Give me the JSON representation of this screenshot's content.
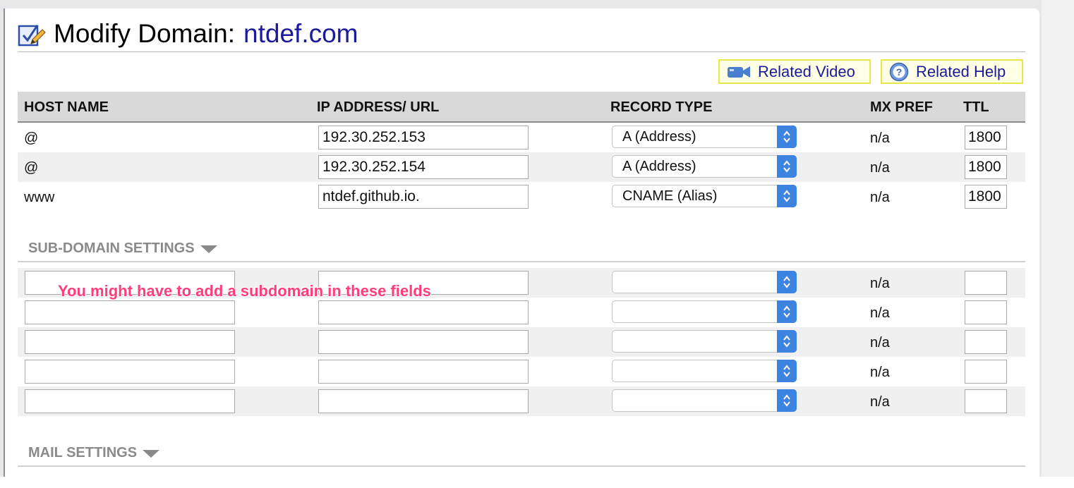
{
  "title": {
    "prefix": "Modify Domain:",
    "domain": "ntdef.com"
  },
  "related": {
    "video_label": "Related Video",
    "help_label": "Related Help"
  },
  "table": {
    "headers": {
      "host": "HOST NAME",
      "ip": "IP ADDRESS/ URL",
      "type": "RECORD TYPE",
      "mx": "MX PREF",
      "ttl": "TTL"
    },
    "records": [
      {
        "host": "@",
        "ip": "192.30.252.153",
        "type": "A (Address)",
        "mx": "n/a",
        "ttl": "1800"
      },
      {
        "host": "@",
        "ip": "192.30.252.154",
        "type": "A (Address)",
        "mx": "n/a",
        "ttl": "1800"
      },
      {
        "host": "www",
        "ip": "ntdef.github.io.",
        "type": "CNAME (Alias)",
        "mx": "n/a",
        "ttl": "1800"
      }
    ]
  },
  "subdomain": {
    "heading": "SUB-DOMAIN SETTINGS",
    "annotation": "You might have to add a subdomain in these fields",
    "rows": [
      {
        "host": "",
        "ip": "",
        "type": "",
        "mx": "n/a",
        "ttl": ""
      },
      {
        "host": "",
        "ip": "",
        "type": "",
        "mx": "n/a",
        "ttl": ""
      },
      {
        "host": "",
        "ip": "",
        "type": "",
        "mx": "n/a",
        "ttl": ""
      },
      {
        "host": "",
        "ip": "",
        "type": "",
        "mx": "n/a",
        "ttl": ""
      },
      {
        "host": "",
        "ip": "",
        "type": "",
        "mx": "n/a",
        "ttl": ""
      }
    ]
  },
  "mail": {
    "heading": "MAIL SETTINGS"
  },
  "colors": {
    "domain": "#1a1a9a",
    "annotation": "#ff3d7a",
    "select_arrow": "#3d83e0",
    "related_border": "#e8e84a"
  },
  "icons": {
    "title": "edit-checkbox-icon",
    "video": "video-camera-icon",
    "help": "help-icon",
    "section": "chevron-down-icon"
  }
}
